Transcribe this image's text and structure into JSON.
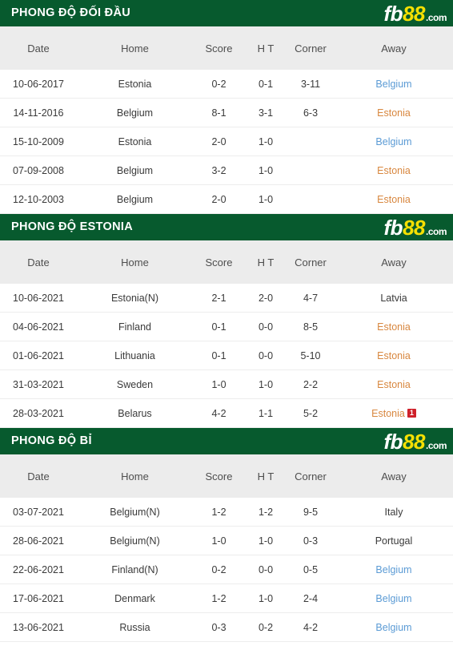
{
  "brand": {
    "logo_fb": "fb",
    "logo_88": "88",
    "logo_com": ".com",
    "green": "#075a2e",
    "yellow": "#f5e003",
    "orange": "#d8873f",
    "blue": "#5b9bd5",
    "red": "#c0392b",
    "badge_red": "#cf2029"
  },
  "columns": {
    "date": "Date",
    "home": "Home",
    "score": "Score",
    "ht": "H T",
    "corner": "Corner",
    "away": "Away"
  },
  "sections": [
    {
      "title": "PHONG ĐỘ ĐỐI ĐẦU",
      "rows": [
        {
          "date": "10-06-2017",
          "home": "Estonia",
          "home_color": "orange",
          "score": "0-2",
          "ht": "0-1",
          "corner": "3-11",
          "away": "Belgium",
          "away_color": "blue",
          "away_badge": ""
        },
        {
          "date": "14-11-2016",
          "home": "Belgium",
          "home_color": "blue",
          "score": "8-1",
          "ht": "3-1",
          "corner": "6-3",
          "away": "Estonia",
          "away_color": "orange",
          "away_badge": ""
        },
        {
          "date": "15-10-2009",
          "home": "Estonia",
          "home_color": "orange",
          "score": "2-0",
          "ht": "1-0",
          "corner": "",
          "away": "Belgium",
          "away_color": "blue",
          "away_badge": ""
        },
        {
          "date": "07-09-2008",
          "home": "Belgium",
          "home_color": "blue",
          "score": "3-2",
          "ht": "1-0",
          "corner": "",
          "away": "Estonia",
          "away_color": "orange",
          "away_badge": ""
        },
        {
          "date": "12-10-2003",
          "home": "Belgium",
          "home_color": "blue",
          "score": "2-0",
          "ht": "1-0",
          "corner": "",
          "away": "Estonia",
          "away_color": "orange",
          "away_badge": ""
        }
      ]
    },
    {
      "title": "PHONG ĐỘ ESTONIA",
      "rows": [
        {
          "date": "10-06-2021",
          "home": "Estonia(N)",
          "home_color": "orange",
          "score": "2-1",
          "ht": "2-0",
          "corner": "4-7",
          "away": "Latvia",
          "away_color": "dark",
          "away_badge": ""
        },
        {
          "date": "04-06-2021",
          "home": "Finland",
          "home_color": "dark",
          "score": "0-1",
          "ht": "0-0",
          "corner": "8-5",
          "away": "Estonia",
          "away_color": "orange",
          "away_badge": ""
        },
        {
          "date": "01-06-2021",
          "home": "Lithuania",
          "home_color": "dark",
          "score": "0-1",
          "ht": "0-0",
          "corner": "5-10",
          "away": "Estonia",
          "away_color": "orange",
          "away_badge": ""
        },
        {
          "date": "31-03-2021",
          "home": "Sweden",
          "home_color": "dark",
          "score": "1-0",
          "ht": "1-0",
          "corner": "2-2",
          "away": "Estonia",
          "away_color": "orange",
          "away_badge": ""
        },
        {
          "date": "28-03-2021",
          "home": "Belarus",
          "home_color": "dark",
          "score": "4-2",
          "ht": "1-1",
          "corner": "5-2",
          "away": "Estonia",
          "away_color": "orange",
          "away_badge": "1"
        }
      ]
    },
    {
      "title": "PHONG ĐỘ BỈ",
      "rows": [
        {
          "date": "03-07-2021",
          "home": "Belgium(N)",
          "home_color": "blue",
          "score": "1-2",
          "ht": "1-2",
          "corner": "9-5",
          "away": "Italy",
          "away_color": "dark",
          "away_badge": ""
        },
        {
          "date": "28-06-2021",
          "home": "Belgium(N)",
          "home_color": "blue",
          "score": "1-0",
          "ht": "1-0",
          "corner": "0-3",
          "away": "Portugal",
          "away_color": "dark",
          "away_badge": ""
        },
        {
          "date": "22-06-2021",
          "home": "Finland(N)",
          "home_color": "dark",
          "score": "0-2",
          "ht": "0-0",
          "corner": "0-5",
          "away": "Belgium",
          "away_color": "blue",
          "away_badge": ""
        },
        {
          "date": "17-06-2021",
          "home": "Denmark",
          "home_color": "dark",
          "score": "1-2",
          "ht": "1-0",
          "corner": "2-4",
          "away": "Belgium",
          "away_color": "blue",
          "away_badge": ""
        },
        {
          "date": "13-06-2021",
          "home": "Russia",
          "home_color": "dark",
          "score": "0-3",
          "ht": "0-2",
          "corner": "4-2",
          "away": "Belgium",
          "away_color": "blue",
          "away_badge": ""
        }
      ]
    }
  ]
}
